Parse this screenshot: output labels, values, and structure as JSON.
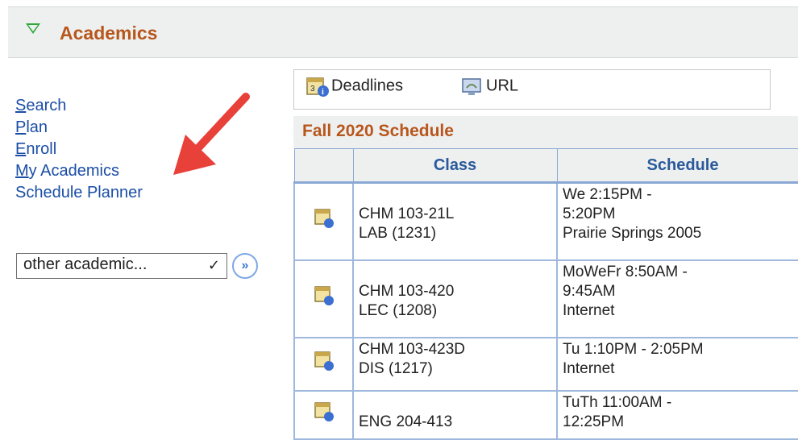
{
  "header": {
    "title": "Academics"
  },
  "nav": {
    "items": [
      {
        "first": "S",
        "rest": "earch"
      },
      {
        "first": "P",
        "rest": "lan"
      },
      {
        "first": "E",
        "rest": "nroll"
      },
      {
        "first": "M",
        "rest": "y Academics"
      },
      {
        "first": "",
        "rest": "Schedule Planner"
      }
    ]
  },
  "other_select": {
    "value": "other academic..."
  },
  "toolbar": {
    "deadlines_label": "Deadlines",
    "url_label": "URL"
  },
  "schedule": {
    "title": "Fall 2020 Schedule",
    "columns": [
      "Class",
      "Schedule"
    ],
    "rows": [
      {
        "class_line1": "CHM 103-21L",
        "class_line2": "LAB (1231)",
        "sched_line1": "We 2:15PM -",
        "sched_line2": "5:20PM",
        "sched_line3": "Prairie Springs 2005"
      },
      {
        "class_line1": "CHM 103-420",
        "class_line2": "LEC (1208)",
        "sched_line1": "MoWeFr 8:50AM -",
        "sched_line2": "9:45AM",
        "sched_line3": "Internet"
      },
      {
        "class_line1": "CHM 103-423D",
        "class_line2": "DIS (1217)",
        "sched_line1": "Tu 1:10PM - 2:05PM",
        "sched_line2": "Internet",
        "sched_line3": ""
      },
      {
        "class_line1": "ENG 204-413",
        "class_line2": "",
        "sched_line1": "TuTh 11:00AM -",
        "sched_line2": "12:25PM",
        "sched_line3": ""
      }
    ]
  },
  "colors": {
    "accent_orange": "#b8561c",
    "link_blue": "#1a4ea6",
    "arrow_red": "#e8413a"
  }
}
